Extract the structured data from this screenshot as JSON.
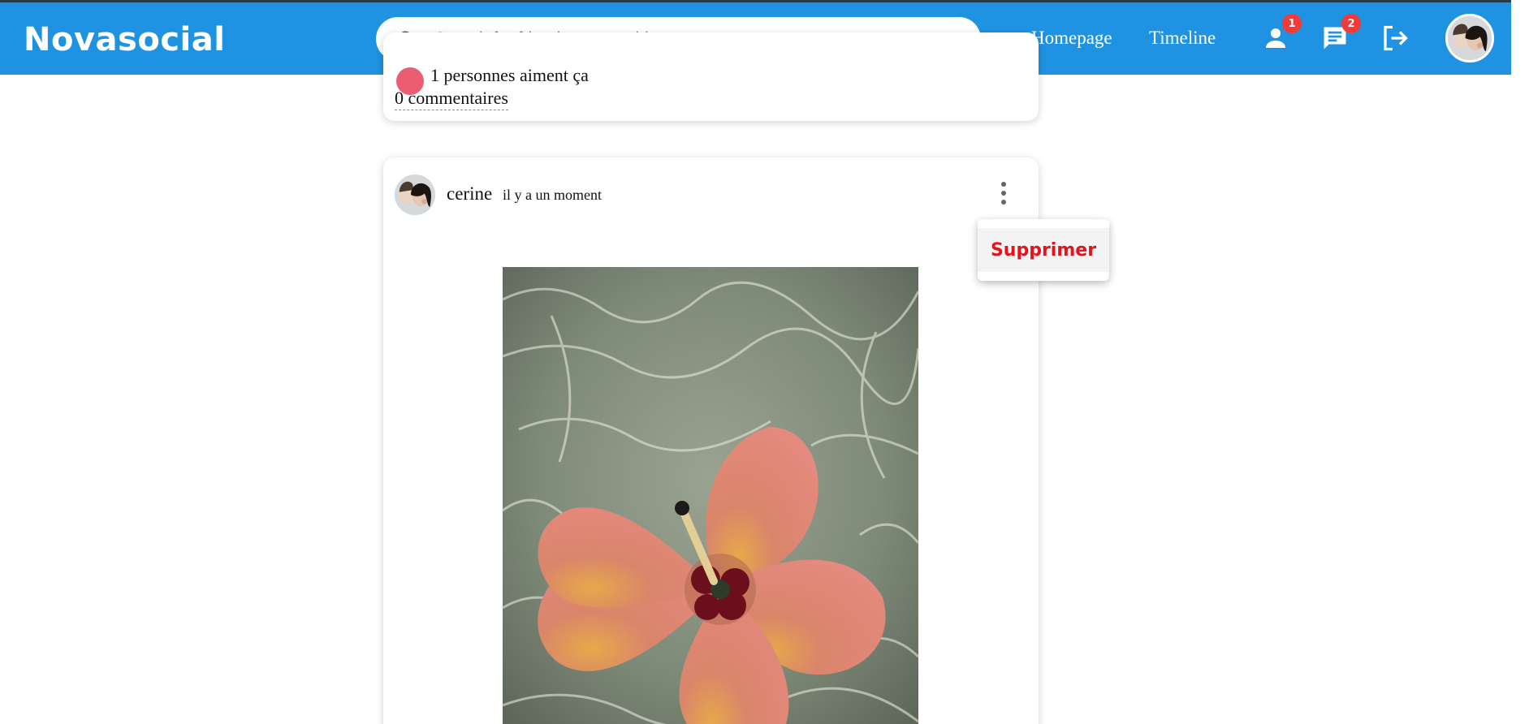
{
  "header": {
    "logo": "Novasocial",
    "search": {
      "placeholder": "Search for friend, post or video",
      "value": ""
    },
    "nav": {
      "homepage": "Homepage",
      "timeline": "Timeline"
    },
    "badges": {
      "friend_requests": "1",
      "messages": "2"
    },
    "colors": {
      "bar": "#1f93e1",
      "badge": "#f13b3b"
    }
  },
  "previous_post": {
    "likes_text": "1 personnes aiment ça",
    "comments_text": "0 commentaires"
  },
  "post": {
    "username": "cerine",
    "time": "il y a un moment",
    "menu": {
      "delete_label": "Supprimer"
    }
  }
}
